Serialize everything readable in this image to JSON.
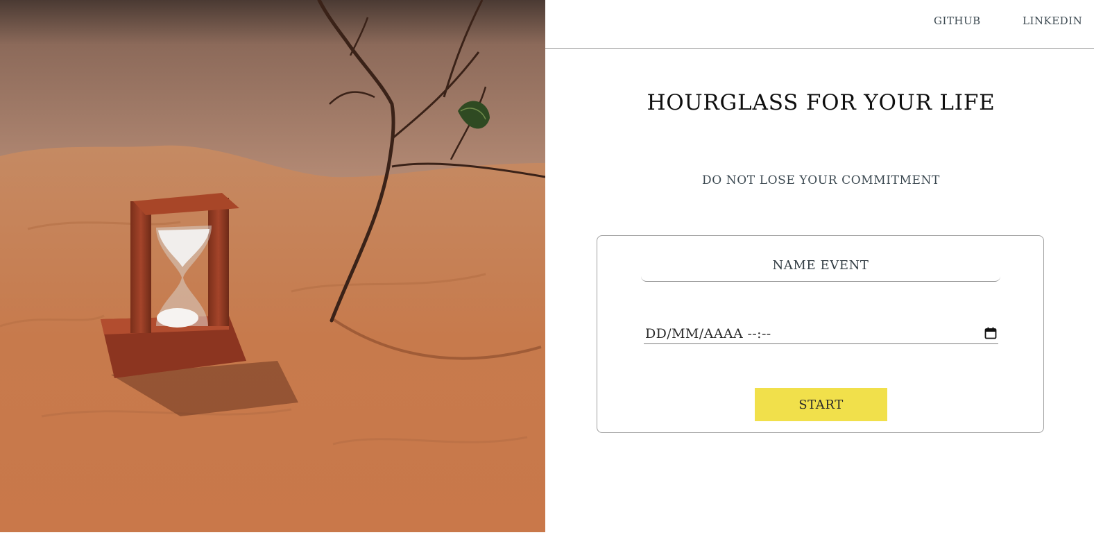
{
  "nav": {
    "github_label": "GITHUB",
    "linkedin_label": "LINKEDIN"
  },
  "hero": {
    "title": "HOURGLASS FOR YOUR LIFE",
    "subtitle": "DO NOT LOSE YOUR COMMITMENT"
  },
  "form": {
    "name_placeholder": "NAME EVENT",
    "name_value": "",
    "date_placeholder": "DD/MM/AAAA --:--",
    "start_label": "START"
  },
  "icons": {
    "calendar": "calendar-icon"
  },
  "colors": {
    "accent_button": "#f1e04b",
    "sand": "#c77a4c",
    "text": "#3d4a52"
  }
}
